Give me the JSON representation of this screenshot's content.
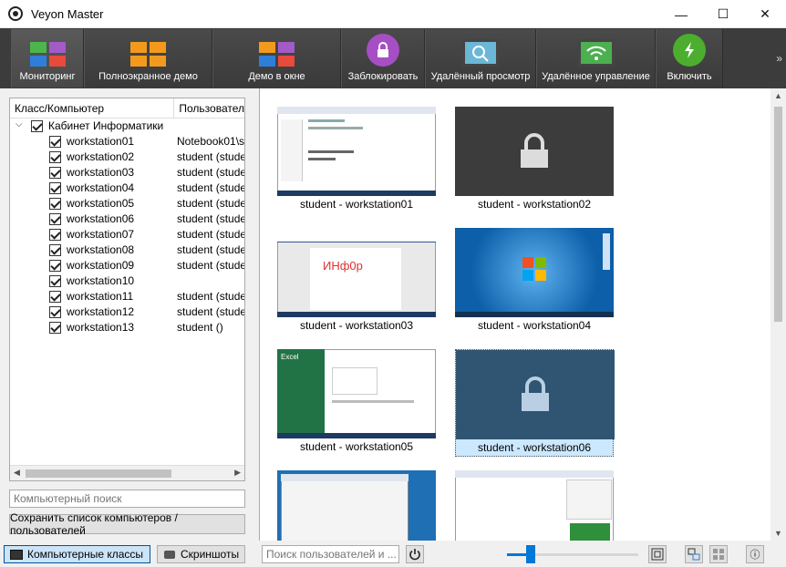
{
  "window": {
    "title": "Veyon Master",
    "minimize_glyph": "—",
    "maximize_glyph": "☐",
    "close_glyph": "✕"
  },
  "toolbar": {
    "buttons": [
      {
        "label": "Мониторинг",
        "icon": "monitoring-icon",
        "active": true
      },
      {
        "label": "Полноэкранное демо",
        "icon": "fullscreen-demo-icon"
      },
      {
        "label": "Демо в окне",
        "icon": "window-demo-icon"
      },
      {
        "label": "Заблокировать",
        "icon": "lock-icon"
      },
      {
        "label": "Удалённый просмотр",
        "icon": "remote-view-icon"
      },
      {
        "label": "Удалённое управление",
        "icon": "remote-control-icon"
      },
      {
        "label": "Включить",
        "icon": "power-on-icon"
      }
    ],
    "more_glyph": "»"
  },
  "tree": {
    "col_computer": "Класс/Компьютер",
    "col_user": "Пользовател",
    "group_name": "Кабинет Информатики",
    "computers": [
      {
        "name": "workstation01",
        "user": "Notebook01\\s"
      },
      {
        "name": "workstation02",
        "user": "student (stude"
      },
      {
        "name": "workstation03",
        "user": "student (stude"
      },
      {
        "name": "workstation04",
        "user": "student (stude"
      },
      {
        "name": "workstation05",
        "user": "student (stude"
      },
      {
        "name": "workstation06",
        "user": "student (stude"
      },
      {
        "name": "workstation07",
        "user": "student (stude"
      },
      {
        "name": "workstation08",
        "user": "student (stude"
      },
      {
        "name": "workstation09",
        "user": "student (stude"
      },
      {
        "name": "workstation10",
        "user": ""
      },
      {
        "name": "workstation11",
        "user": "student (stude"
      },
      {
        "name": "workstation12",
        "user": "student (stude"
      },
      {
        "name": "workstation13",
        "user": "student ()"
      }
    ]
  },
  "left_search": {
    "placeholder": "Компьютерный поиск"
  },
  "save_button": "Сохранить список компьютеров / пользователей",
  "tiles": [
    {
      "caption": "student - workstation01",
      "kind": "code"
    },
    {
      "caption": "student - workstation02",
      "kind": "locked"
    },
    {
      "caption": "student - workstation03",
      "kind": "word",
      "screen_text": "ИНф0р"
    },
    {
      "caption": "student - workstation04",
      "kind": "desktop"
    },
    {
      "caption": "student - workstation05",
      "kind": "excel",
      "screen_text": "Excel"
    },
    {
      "caption": "student - workstation06",
      "kind": "locked-selected"
    },
    {
      "caption": "",
      "kind": "window"
    },
    {
      "caption": "",
      "kind": "ide"
    }
  ],
  "bottom": {
    "classes_button": "Компьютерные классы",
    "screenshots_button": "Скриншоты",
    "user_search_placeholder": "Поиск пользователей и ...",
    "zoom_level": 0.18,
    "info_glyph": "ⓘ"
  },
  "colors": {
    "toolbar_bg": "#3c3c3c",
    "lock_purple": "#a64fc4",
    "power_green": "#4cae2e",
    "accent_blue": "#0078d7"
  }
}
